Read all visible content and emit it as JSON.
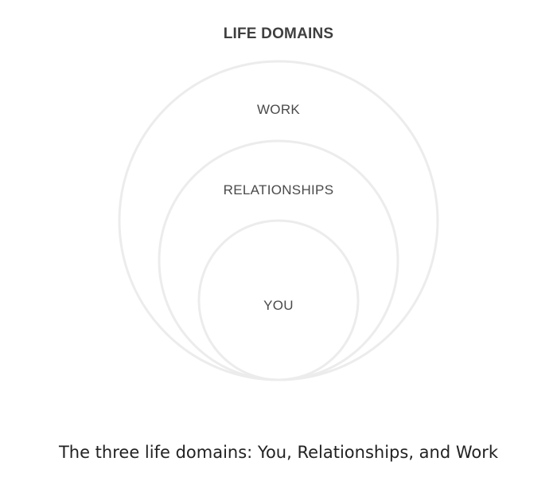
{
  "diagram": {
    "title": "LIFE DOMAINS",
    "domains": [
      {
        "label": "WORK"
      },
      {
        "label": "RELATIONSHIPS"
      },
      {
        "label": "YOU"
      }
    ],
    "ring_stroke_color": "#ececec"
  },
  "caption": "The three life domains: You, Relationships, and Work"
}
